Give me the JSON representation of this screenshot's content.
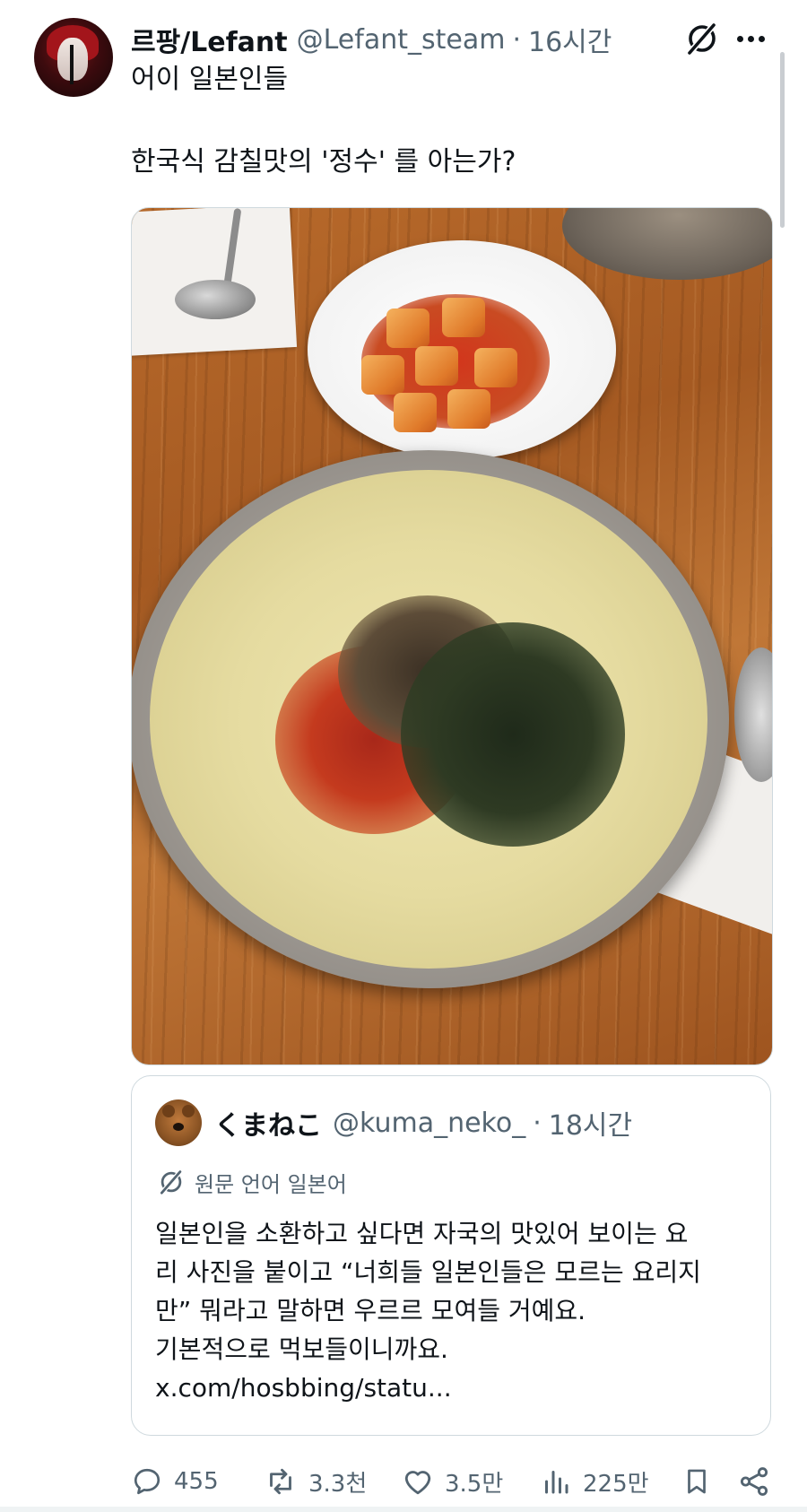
{
  "tweet": {
    "author_name": "르팡/Lefant",
    "author_handle": "@Lefant_steam",
    "separator": "·",
    "time": "16시간",
    "text_line1": "어이 일본인들",
    "text_line2": "한국식 감칠맛의 '정수' 를 아는가?",
    "icons": {
      "translate": "grok-slash-icon",
      "more": "more-icon"
    }
  },
  "quoted": {
    "author_name": "くまねこ",
    "author_handle": "@kuma_neko_",
    "separator": "·",
    "time": "18시간",
    "translation_note": "원문 언어 일본어",
    "body_lines": [
      "일본인을 소환하고 싶다면 자국의 맛있어 보이는 요",
      "리 사진을 붙이고 “너희들 일본인들은 모르는 요리지",
      "만” 뭐라고 말하면 우르르 모여들 거예요.",
      "기본적으로 먹보들이니까요.",
      "x.com/hosbbing/statu..."
    ]
  },
  "actions": {
    "replies": "455",
    "reposts": "3.3천",
    "likes": "3.5만",
    "views": "225만"
  },
  "colors": {
    "text": "#0f1419",
    "secondary": "#536471",
    "border": "#cfd9de"
  }
}
